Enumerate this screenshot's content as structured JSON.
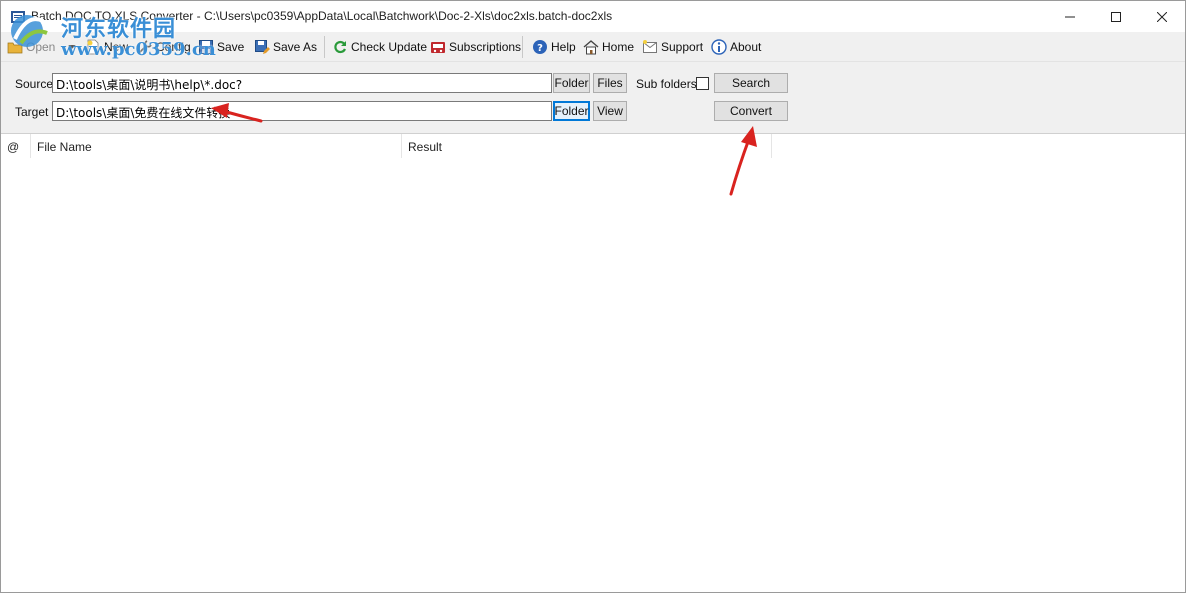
{
  "window": {
    "title": "Batch DOC TO XLS Converter - C:\\Users\\pc0359\\AppData\\Local\\Batchwork\\Doc-2-Xls\\doc2xls.batch-doc2xls",
    "controls": {
      "minimize": "—",
      "maximize": "☐",
      "close": "✕"
    }
  },
  "toolbar": {
    "items": [
      {
        "label": "Open",
        "icon": "open-folder-icon"
      },
      {
        "label": "New",
        "icon": "new-file-icon"
      },
      {
        "label": "Config",
        "icon": "wrench-icon"
      },
      {
        "label": "Save",
        "icon": "floppy-icon"
      },
      {
        "label": "Save As",
        "icon": "save-as-icon"
      },
      {
        "label": "Check Update",
        "icon": "refresh-icon"
      },
      {
        "label": "Subscriptions",
        "icon": "cart-icon"
      },
      {
        "label": "Help",
        "icon": "help-icon"
      },
      {
        "label": "Home",
        "icon": "home-icon"
      },
      {
        "label": "Support",
        "icon": "support-icon"
      },
      {
        "label": "About",
        "icon": "info-icon"
      }
    ]
  },
  "form": {
    "source_label": "Source",
    "source_value": "D:\\tools\\桌面\\说明书\\help\\*.doc?",
    "target_label": "Target",
    "target_value": "D:\\tools\\桌面\\免费在线文件转换",
    "folder_button": "Folder",
    "files_button": "Files",
    "view_button": "View",
    "subfolders_label": "Sub folders",
    "subfolders_checked": false,
    "search_button": "Search",
    "convert_button": "Convert"
  },
  "list": {
    "columns": [
      "@",
      "File Name",
      "Result"
    ]
  },
  "watermark": {
    "name": "河东软件园",
    "url": "www.pc0359.cn"
  },
  "colors": {
    "toolbar_bg": "#f0f0f0",
    "accent": "#0078d7",
    "arrow": "#d9231f",
    "watermark": "#3a8fd6"
  }
}
